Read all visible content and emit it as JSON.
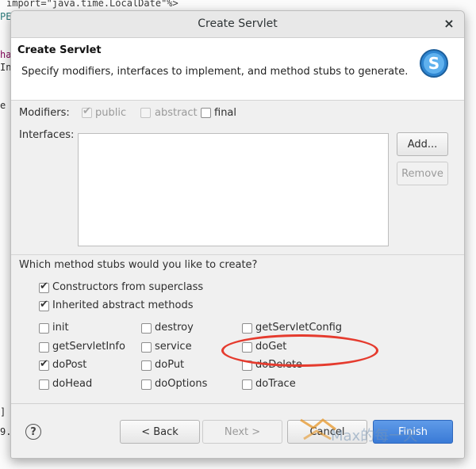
{
  "editor": {
    "line1": "import=\"java.time.LocalDate\"%>",
    "frag_pe": "PE",
    "frag_ha": "ha",
    "frag_in": "In",
    "frag_e": "e",
    "frag_p": "] P",
    "frag_9": "9.("
  },
  "dialog": {
    "title": "Create Servlet",
    "close_glyph": "×",
    "header": {
      "title": "Create Servlet",
      "description": "Specify modifiers, interfaces to implement, and method stubs to generate.",
      "logo_icon": "servlet-wizard-icon"
    },
    "modifiers": {
      "label": "Modifiers:",
      "public": "public",
      "abstract": "abstract",
      "final": "final",
      "public_checked": true,
      "abstract_checked": false,
      "final_checked": false
    },
    "interfaces": {
      "label": "Interfaces:",
      "add_button": "Add...",
      "remove_button": "Remove"
    },
    "stubs": {
      "question": "Which method stubs would you like to create?",
      "constructors": "Constructors from superclass",
      "inherited": "Inherited abstract methods",
      "methods": [
        {
          "label": "init",
          "checked": false
        },
        {
          "label": "destroy",
          "checked": false
        },
        {
          "label": "getServletConfig",
          "checked": false
        },
        {
          "label": "getServletInfo",
          "checked": false
        },
        {
          "label": "service",
          "checked": false
        },
        {
          "label": "doGet",
          "checked": false
        },
        {
          "label": "doPost",
          "checked": true
        },
        {
          "label": "doPut",
          "checked": false
        },
        {
          "label": "doDelete",
          "checked": false
        },
        {
          "label": "doHead",
          "checked": false
        },
        {
          "label": "doOptions",
          "checked": false
        },
        {
          "label": "doTrace",
          "checked": false
        }
      ]
    },
    "footer": {
      "help_glyph": "?",
      "back": "< Back",
      "next": "Next >",
      "cancel": "Cancel",
      "finish": "Finish"
    },
    "watermark": "Max的每一天"
  },
  "colors": {
    "annotation": "#e53b2e",
    "primary_button": "#3a7ad6"
  }
}
